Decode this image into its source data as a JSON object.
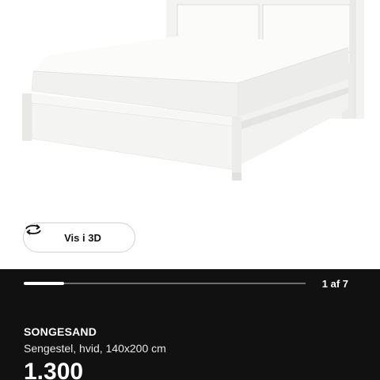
{
  "gallery": {
    "image_alt": "SONGESAND bed frame, white",
    "view_3d_label": "Vis i 3D",
    "view_3d_icon": "rotate-3d-icon",
    "current_image": 1,
    "total_images": 7,
    "page_indicator": "1 af 7"
  },
  "product": {
    "name": "SONGESAND",
    "description": "Sengestel, hvid, 140x200 cm",
    "price": "1.300"
  },
  "colors": {
    "panel_background": "#111111",
    "progress_track": "#6d6d6d",
    "progress_fill": "#ffffff"
  }
}
